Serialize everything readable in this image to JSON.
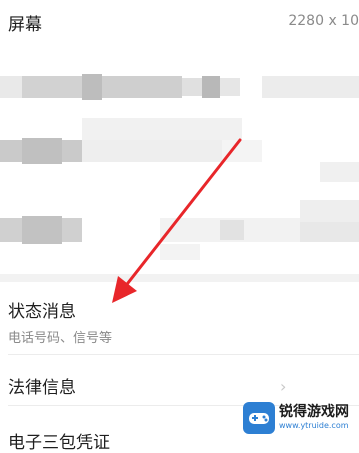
{
  "settings": {
    "screen_label": "屏幕",
    "screen_value": "2280 x 10",
    "status_title": "状态消息",
    "status_subtitle": "电话号码、信号等",
    "legal_label": "法律信息",
    "ewarranty_label": "电子三包凭证"
  },
  "watermark": {
    "text": "锐得游戏网",
    "url": "www.ytruide.com"
  },
  "colors": {
    "arrow": "#e8262a",
    "watermark_blue": "#2d7fd3"
  }
}
